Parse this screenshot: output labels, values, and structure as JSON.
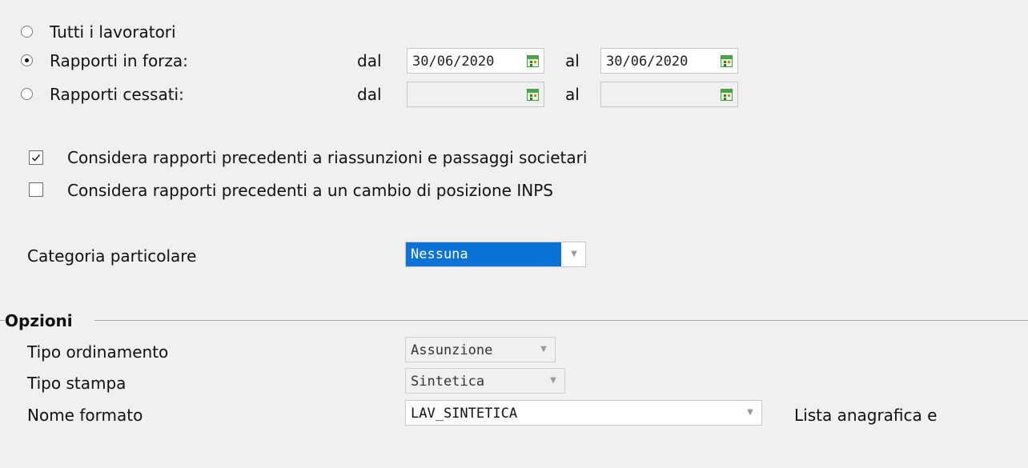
{
  "filters": {
    "options": [
      {
        "label": "Tutti i lavoratori",
        "selected": false
      },
      {
        "label": "Rapporti in forza:",
        "selected": true
      },
      {
        "label": "Rapporti cessati:",
        "selected": false
      }
    ],
    "from_label": "dal",
    "to_label": "al",
    "in_forza": {
      "from": "30/06/2020",
      "to": "30/06/2020"
    },
    "cessati": {
      "from": "",
      "to": ""
    }
  },
  "checks": [
    {
      "label": "Considera rapporti precedenti a riassunzioni e passaggi societari",
      "checked": true
    },
    {
      "label": "Considera rapporti precedenti a un cambio di posizione INPS",
      "checked": false
    }
  ],
  "categoria": {
    "label": "Categoria particolare",
    "value": "Nessuna"
  },
  "options_section": {
    "title": "Opzioni",
    "tipo_ordinamento": {
      "label": "Tipo ordinamento",
      "value": "Assunzione"
    },
    "tipo_stampa": {
      "label": "Tipo stampa",
      "value": "Sintetica"
    },
    "nome_formato": {
      "label": "Nome formato",
      "value": "LAV_SINTETICA",
      "description": "Lista anagrafica e"
    }
  },
  "colors": {
    "selection_blue": "#0b73d8",
    "background": "#f0f0f0"
  }
}
